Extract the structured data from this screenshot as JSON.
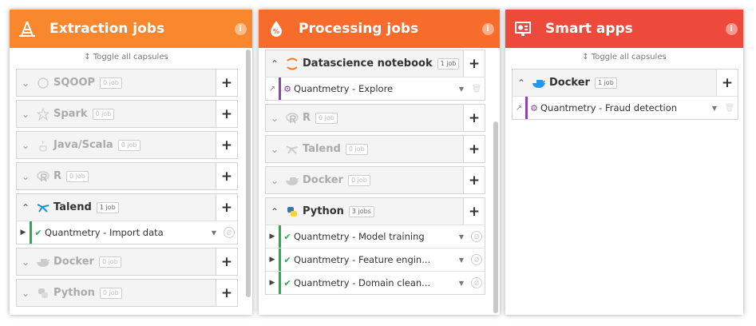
{
  "colors": {
    "extraction_header": "#f8872d",
    "processing_header": "#f86c2b",
    "smart_header": "#ee4a3c",
    "success_stripe": "#23b14d",
    "notebook_stripe": "#8e44ad"
  },
  "extraction": {
    "title": "Extraction jobs",
    "info": "i",
    "toggle_label": "↕ Toggle all capsules",
    "capsules": [
      {
        "name": "SQOOP",
        "badge": "0 job"
      },
      {
        "name": "Spark",
        "badge": "0 job"
      },
      {
        "name": "Java/Scala",
        "badge": "0 job"
      },
      {
        "name": "R",
        "badge": "0 job"
      },
      {
        "name": "Talend",
        "badge": "1 job",
        "jobs": [
          {
            "name": "Quantmetry - Import data"
          }
        ]
      },
      {
        "name": "Docker",
        "badge": "0 job"
      },
      {
        "name": "Python",
        "badge": "0 job"
      }
    ]
  },
  "processing": {
    "title": "Processing jobs",
    "info": "i",
    "capsules": [
      {
        "name": "Datascience notebook",
        "badge": "1 job",
        "jobs": [
          {
            "name": "Quantmetry - Explore"
          }
        ]
      },
      {
        "name": "R",
        "badge": "0 job"
      },
      {
        "name": "Talend",
        "badge": "0 job"
      },
      {
        "name": "Docker",
        "badge": "0 job"
      },
      {
        "name": "Python",
        "badge": "3 jobs",
        "jobs": [
          {
            "name": "Quantmetry - Model training"
          },
          {
            "name": "Quantmetry - Feature engin..."
          },
          {
            "name": "Quantmetry - Domain clean..."
          }
        ]
      }
    ]
  },
  "smart": {
    "title": "Smart apps",
    "info": "i",
    "toggle_label": "↕ Toggle all capsules",
    "capsules": [
      {
        "name": "Docker",
        "badge": "1 job",
        "jobs": [
          {
            "name": "Quantmetry - Fraud detection"
          }
        ]
      }
    ]
  },
  "glyphs": {
    "plus": "+",
    "chevron_down": "⌄",
    "chevron_up": "⌃",
    "play": "▶",
    "check": "✔",
    "caret": "▼",
    "trash": "🗑",
    "external": "↗",
    "gears": "⚙",
    "disabled": "Ø"
  }
}
